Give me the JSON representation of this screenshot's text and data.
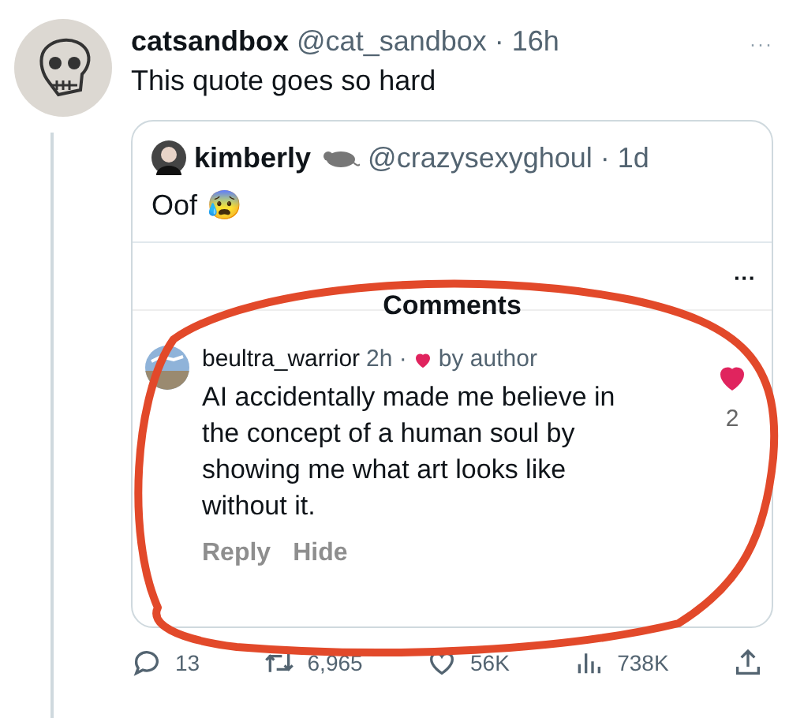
{
  "tweet": {
    "name": "catsandbox",
    "handle": "@cat_sandbox",
    "time": "· 16h",
    "text": "This quote goes so hard",
    "more": "···"
  },
  "quote": {
    "name": "kimberly",
    "handle": "@crazysexyghoul",
    "time": "· 1d",
    "text": "Oof",
    "emoji": "😰",
    "screenshot": {
      "title": "Comments",
      "more": "···",
      "comment": {
        "user": "beultra_warrior",
        "time": "2h ·",
        "badge": "by author",
        "text": "AI accidentally made me believe in the concept of a human soul by showing me what art looks like without it.",
        "likes": "2",
        "liked": true,
        "actions": [
          "Reply",
          "Hide"
        ]
      }
    }
  },
  "stats": [
    {
      "kind": "reply",
      "count": "13"
    },
    {
      "kind": "retweet",
      "count": "6,965"
    },
    {
      "kind": "like",
      "count": "56K"
    },
    {
      "kind": "views",
      "count": "738K"
    },
    {
      "kind": "share"
    }
  ]
}
